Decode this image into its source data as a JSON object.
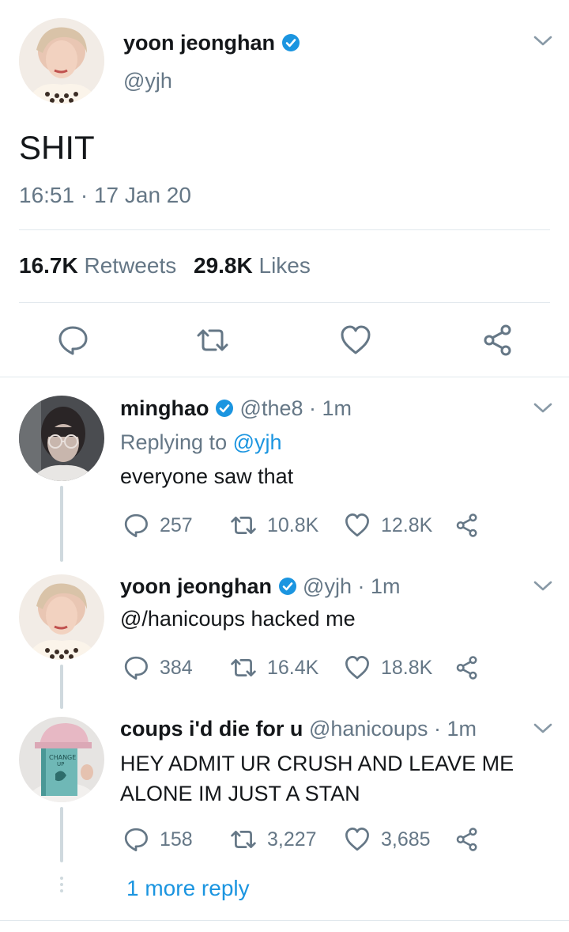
{
  "colors": {
    "accent": "#1b95e0",
    "text": "#14171a",
    "muted": "#657786",
    "divider": "#e1e8ed"
  },
  "main_tweet": {
    "display_name": "yoon jeonghan",
    "handle": "@yjh",
    "text": "SHIT",
    "timestamp": "16:51 · 17 Jan 20",
    "retweets_count": "16.7K",
    "retweets_label": "Retweets",
    "likes_count": "29.8K",
    "likes_label": "Likes",
    "icons": [
      "reply-icon",
      "retweet-icon",
      "like-icon",
      "share-icon"
    ]
  },
  "replies": [
    {
      "display_name": "minghao",
      "meta": "@the8 · 1m",
      "replying_prefix": "Replying to",
      "replying_handle": "@yjh",
      "text": "everyone saw that",
      "reply_count": "257",
      "retweet_count": "10.8K",
      "like_count": "12.8K"
    },
    {
      "display_name": "yoon jeonghan",
      "meta": "@yjh · 1m",
      "text": "@/hanicoups hacked me",
      "reply_count": "384",
      "retweet_count": "16.4K",
      "like_count": "18.8K"
    },
    {
      "display_name": "coups i'd die for u",
      "meta": "@hanicoups · 1m",
      "text_line1": "HEY ADMIT UR CRUSH AND LEAVE ME",
      "text_line2": "ALONE IM JUST A STAN",
      "reply_count": "158",
      "retweet_count": "3,227",
      "like_count": "3,685"
    }
  ],
  "more_replies": "1 more reply"
}
